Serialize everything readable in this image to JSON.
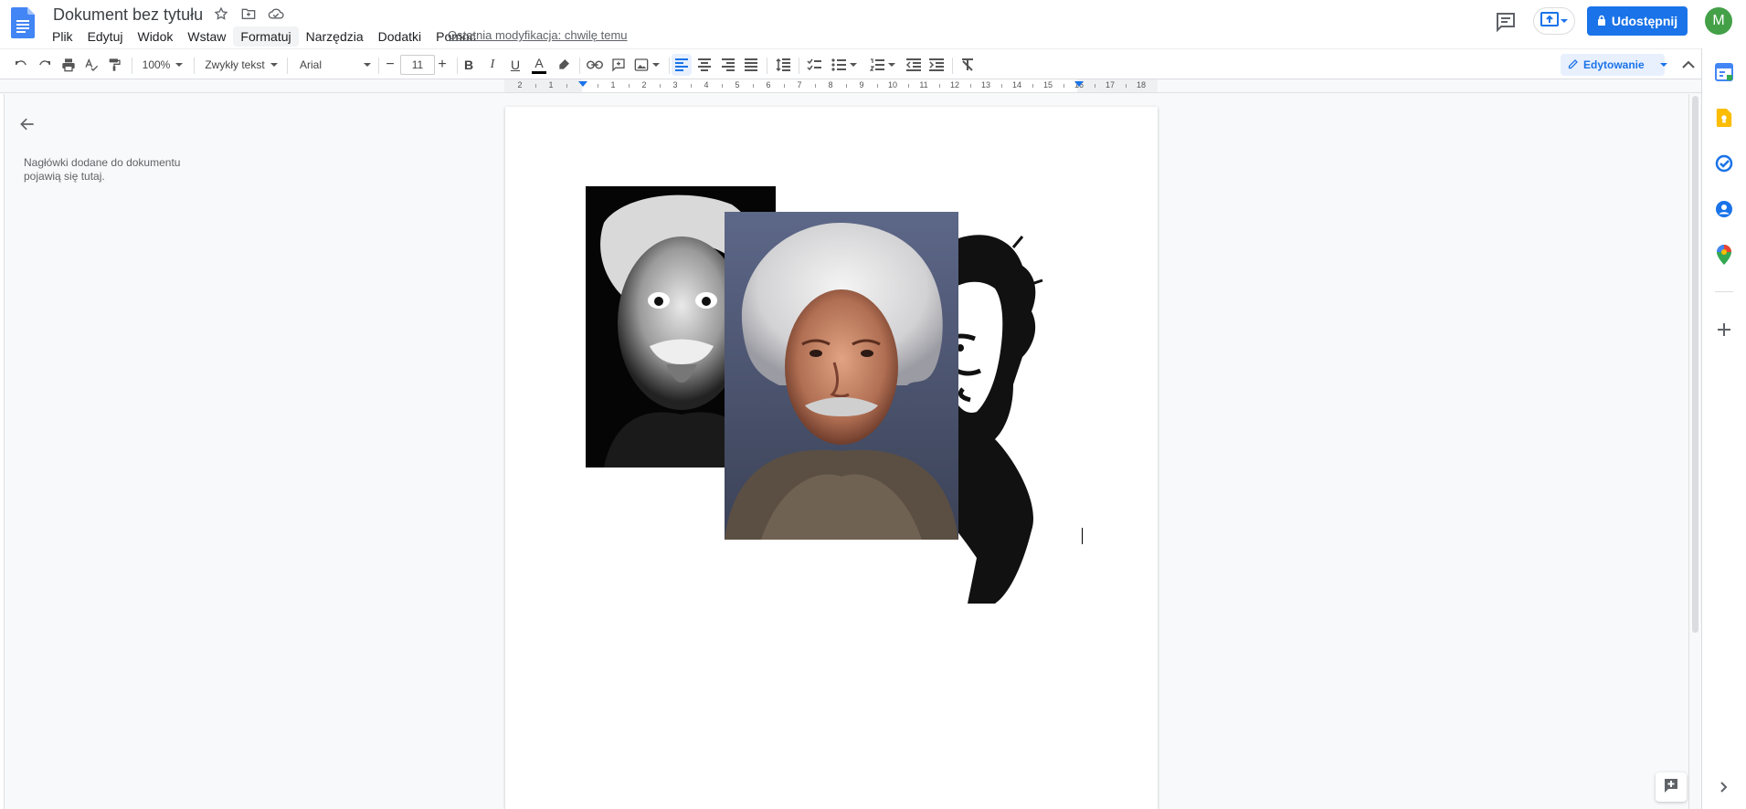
{
  "document": {
    "title": "Dokument bez tytułu",
    "last_modified": "Ostatnia modyfikacja: chwilę temu"
  },
  "menu": [
    "Plik",
    "Edytuj",
    "Widok",
    "Wstaw",
    "Formatuj",
    "Narzędzia",
    "Dodatki",
    "Pomoc"
  ],
  "header": {
    "share_label": "Udostępnij",
    "avatar_letter": "M",
    "accent": "#1a73e8"
  },
  "toolbar": {
    "zoom": "100%",
    "paragraph_style": "Zwykły tekst",
    "font": "Arial",
    "font_size": "11",
    "decrease_symbol": "−",
    "increase_symbol": "+",
    "bold": "B",
    "italic": "I",
    "underline": "U",
    "text_color_letter": "A",
    "mode": "Edytowanie"
  },
  "ruler": {
    "labels": [
      "2",
      "1",
      "1",
      "2",
      "3",
      "4",
      "5",
      "6",
      "7",
      "8",
      "9",
      "10",
      "11",
      "12",
      "13",
      "14",
      "15",
      "16",
      "17",
      "18"
    ]
  },
  "outline": {
    "hint": "Nagłówki dodane do dokumentu pojawią się tutaj."
  },
  "images": [
    {
      "name": "einstein-tongue-bw",
      "kind": "photo"
    },
    {
      "name": "einstein-color-portrait",
      "kind": "photo"
    },
    {
      "name": "einstein-stencil",
      "kind": "illustration"
    }
  ],
  "side_panel": [
    "calendar-icon",
    "keep-icon",
    "tasks-icon",
    "contacts-icon",
    "maps-icon",
    "add-icon"
  ]
}
